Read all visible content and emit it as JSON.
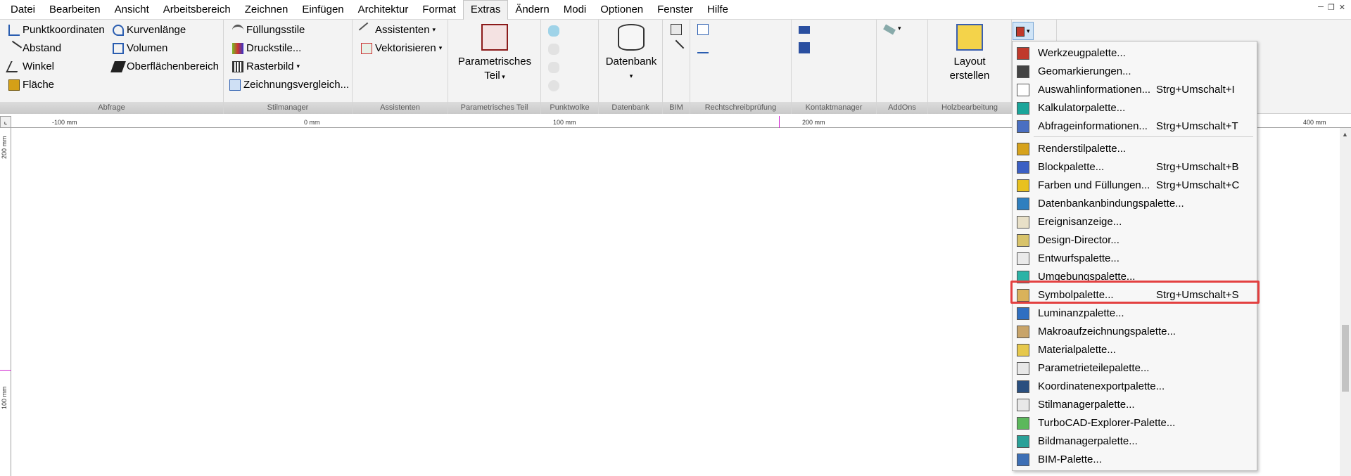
{
  "menu": [
    "Datei",
    "Bearbeiten",
    "Ansicht",
    "Arbeitsbereich",
    "Zeichnen",
    "Einfügen",
    "Architektur",
    "Format",
    "Extras",
    "Ändern",
    "Modi",
    "Optionen",
    "Fenster",
    "Hilfe"
  ],
  "active_menu": "Extras",
  "ribbon": {
    "abfrage": {
      "footer": "Abfrage",
      "items": [
        "Punktkoordinaten",
        "Kurvenlänge",
        "Abstand",
        "Volumen",
        "Winkel",
        "Oberflächenbereich",
        "Fläche"
      ]
    },
    "stilmanager": {
      "footer": "Stilmanager",
      "items": [
        "Füllungsstile",
        "Druckstile...",
        "Rasterbild",
        "Zeichnungsvergleich..."
      ]
    },
    "assistenten": {
      "footer": "Assistenten",
      "items": [
        "Assistenten",
        "Vektorisieren"
      ]
    },
    "parametrisch": {
      "footer": "Parametrisches Teil",
      "label_line1": "Parametrisches",
      "label_line2": "Teil"
    },
    "punktwolke": {
      "footer": "Punktwolke"
    },
    "datenbank": {
      "footer": "Datenbank",
      "label": "Datenbank"
    },
    "bim": {
      "footer": "BIM"
    },
    "rechtschreib": {
      "footer": "Rechtschreibprüfung"
    },
    "kontakt": {
      "footer": "Kontaktmanager"
    },
    "addons": {
      "footer": "AddOns"
    },
    "holz": {
      "footer": "Holzbearbeitung",
      "label_line1": "Layout",
      "label_line2": "erstellen"
    }
  },
  "ruler": {
    "h_labels": [
      "-100 mm",
      "0 mm",
      "100 mm",
      "200 mm",
      "400 mm"
    ],
    "v_labels": [
      "200 mm",
      "100 mm"
    ]
  },
  "dropdown": {
    "items": [
      {
        "label": "Werkzeugpalette...",
        "shortcut": "",
        "icon": "toolbox-icon",
        "color": "#c0392b"
      },
      {
        "label": "Geomarkierungen...",
        "shortcut": "",
        "icon": "geomarker-icon",
        "color": "#444444"
      },
      {
        "label": "Auswahlinformationen...",
        "shortcut": "Strg+Umschalt+I",
        "icon": "cursor-icon",
        "color": "#ffffff"
      },
      {
        "label": "Kalkulatorpalette...",
        "shortcut": "",
        "icon": "calculator-icon",
        "color": "#1aa59a"
      },
      {
        "label": "Abfrageinformationen...",
        "shortcut": "Strg+Umschalt+T",
        "icon": "query-info-icon",
        "color": "#4a6fc2"
      },
      {
        "label": "Renderstilpalette...",
        "shortcut": "",
        "icon": "render-style-icon",
        "color": "#d6a21c"
      },
      {
        "label": "Blockpalette...",
        "shortcut": "Strg+Umschalt+B",
        "icon": "block-icon",
        "color": "#3b5fc4"
      },
      {
        "label": "Farben und Füllungen...",
        "shortcut": "Strg+Umschalt+C",
        "icon": "colors-fills-icon",
        "color": "#e8c11f"
      },
      {
        "label": "Datenbankanbindungspalette...",
        "shortcut": "",
        "icon": "database-link-icon",
        "color": "#2f7fbf"
      },
      {
        "label": "Ereignisanzeige...",
        "shortcut": "",
        "icon": "event-viewer-icon",
        "color": "#e8e0c8"
      },
      {
        "label": "Design-Director...",
        "shortcut": "",
        "icon": "design-director-icon",
        "color": "#d8c36a"
      },
      {
        "label": "Entwurfspalette...",
        "shortcut": "",
        "icon": "draft-palette-icon",
        "color": "#eaeaea"
      },
      {
        "label": "Umgebungspalette...",
        "shortcut": "",
        "icon": "environment-icon",
        "color": "#2bb3a6"
      },
      {
        "label": "Symbolpalette...",
        "shortcut": "Strg+Umschalt+S",
        "icon": "symbol-palette-icon",
        "color": "#d9b25a"
      },
      {
        "label": "Luminanzpalette...",
        "shortcut": "",
        "icon": "luminance-icon",
        "color": "#2f6fc1"
      },
      {
        "label": "Makroaufzeichnungspalette...",
        "shortcut": "",
        "icon": "macro-record-icon",
        "color": "#c8a46a"
      },
      {
        "label": "Materialpalette...",
        "shortcut": "",
        "icon": "material-icon",
        "color": "#e6c84c"
      },
      {
        "label": "Parametrieteilepalette...",
        "shortcut": "",
        "icon": "parametric-parts-icon",
        "color": "#e8e8e8"
      },
      {
        "label": "Koordinatenexportpalette...",
        "shortcut": "",
        "icon": "coordinate-export-icon",
        "color": "#2a4f7f"
      },
      {
        "label": "Stilmanagerpalette...",
        "shortcut": "",
        "icon": "style-manager-icon",
        "color": "#e8e8e8"
      },
      {
        "label": "TurboCAD-Explorer-Palette...",
        "shortcut": "",
        "icon": "explorer-icon",
        "color": "#5cb85c"
      },
      {
        "label": "Bildmanagerpalette...",
        "shortcut": "",
        "icon": "image-manager-icon",
        "color": "#2aa198"
      },
      {
        "label": "BIM-Palette...",
        "shortcut": "",
        "icon": "bim-palette-icon",
        "color": "#3d6fb5"
      }
    ],
    "highlighted": "Symbolpalette..."
  }
}
